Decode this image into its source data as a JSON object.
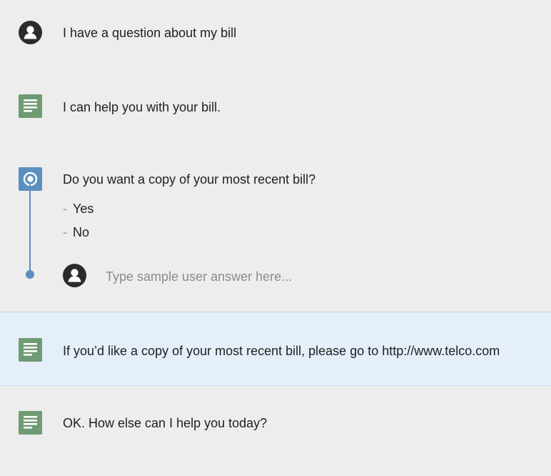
{
  "conversation": {
    "user_message": "I have a question about my bill",
    "bot_reply_1": "I can help you with your bill.",
    "question": {
      "text": "Do you want a copy of your most recent bill?",
      "options": [
        {
          "dash": "-",
          "label": "Yes"
        },
        {
          "dash": "-",
          "label": "No"
        }
      ],
      "answer_placeholder": "Type sample user answer here..."
    },
    "bot_reply_2": "If you’d like a copy of your most recent bill, please go to http://www.telco.com",
    "bot_reply_3": "OK. How else can I help you today?"
  },
  "icons": {
    "user": "user-avatar-icon",
    "bot": "document-icon",
    "question": "radio-target-icon"
  },
  "colors": {
    "background": "#ededed",
    "highlight_row": "#e4effa",
    "bot_icon": "#6f9b72",
    "question_icon": "#5b8fc0",
    "user_icon": "#2b2b2b",
    "connector": "#5b8fc0"
  }
}
